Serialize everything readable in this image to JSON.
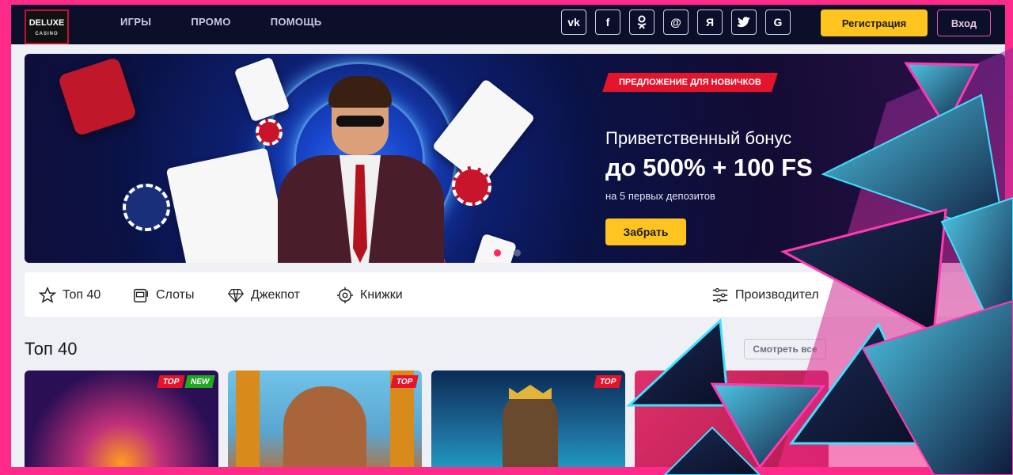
{
  "header": {
    "logo_text": "DELUXE",
    "logo_sub": "CASINO",
    "nav": [
      "ИГРЫ",
      "ПРОМО",
      "ПОМОЩЬ"
    ],
    "social": [
      "vk",
      "f",
      "ok",
      "@",
      "Я",
      "twitter",
      "G"
    ],
    "register_label": "Регистрация",
    "login_label": "Вход"
  },
  "banner": {
    "tag": "ПРЕДЛОЖЕНИЕ ДЛЯ НОВИЧКОВ",
    "title": "Приветственный бонус",
    "amount": "до 500% + 100 FS",
    "subtitle": "на 5 первых депозитов",
    "cta": "Забрать",
    "active_slide": 1,
    "slides": 2
  },
  "categories": [
    {
      "icon": "star-icon",
      "label": "Топ 40"
    },
    {
      "icon": "slot-machine-icon",
      "label": "Слоты"
    },
    {
      "icon": "diamond-icon",
      "label": "Джекпот"
    },
    {
      "icon": "book-icon",
      "label": "Книжки"
    },
    {
      "icon": "filter-icon",
      "label": "Производител"
    }
  ],
  "section": {
    "title": "Топ 40",
    "see_all": "Смотреть все"
  },
  "games": [
    {
      "badges": [
        "TOP",
        "NEW"
      ],
      "colors": [
        "#2a0f55",
        "#ff9d1e"
      ]
    },
    {
      "badges": [
        "TOP"
      ],
      "colors": [
        "#d88a1a",
        "#6fc3e8"
      ]
    },
    {
      "badges": [
        "TOP"
      ],
      "colors": [
        "#0a2a55",
        "#1ea0c8"
      ]
    },
    {
      "badges": [],
      "colors": [
        "#b01b50",
        "#e0306a"
      ]
    }
  ],
  "colors": {
    "accent_yellow": "#ffc41f",
    "accent_red": "#e3142b",
    "header_bg": "#0b0f2a",
    "frame_pink": "#ff2a8a"
  }
}
